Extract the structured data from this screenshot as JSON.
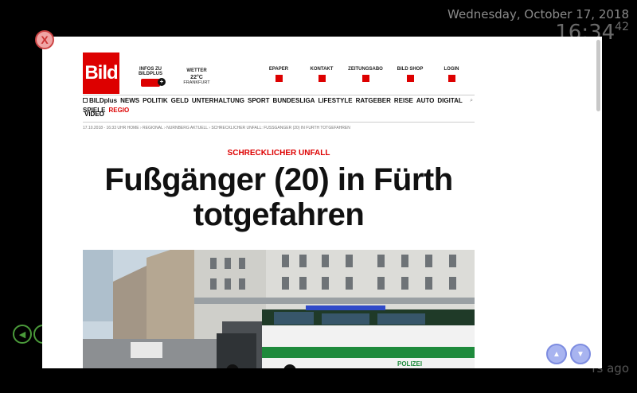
{
  "clock": {
    "date": "Wednesday, October 17, 2018",
    "time": "16:34",
    "seconds": "42"
  },
  "status": {
    "ago_text": "rs ago"
  },
  "overlay": {
    "close_label": "X",
    "prev_label": "◀",
    "up_label": "▲",
    "down_label": "▼"
  },
  "site": {
    "logo_text": "Bild",
    "header": {
      "bildplus_label": "INFOS ZU BILDPLUS",
      "weather_label": "WETTER",
      "weather_temp": "22°C",
      "weather_city": "FRANKFURT",
      "epaper_label": "EPAPER",
      "kontakt_label": "KONTAKT",
      "zeitungsabo_label": "ZEITUNGSABO",
      "shop_label": "BILD SHOP",
      "login_label": "LOGIN"
    },
    "menu": [
      "BILDplus",
      "NEWS",
      "POLITIK",
      "GELD",
      "UNTERHALTUNG",
      "SPORT",
      "BUNDESLIGA",
      "LIFESTYLE",
      "RATGEBER",
      "REISE",
      "AUTO",
      "DIGITAL",
      "SPIELE"
    ],
    "menu_regio": "REGIO",
    "menu_video": "VIDEO",
    "breadcrumb": "17.10.2018 - 16:33 UHR   HOME › REGIONAL › NÜRNBERG AKTUELL › SCHRECKLICHER UNFALL: FUSSGÄNGER (20) IN FÜRTH TOTGEFAHREN",
    "article": {
      "kicker": "SCHRECKLICHER UNFALL",
      "headline_line1": "Fußgänger (20) in Fürth",
      "headline_line2": "totgefahren"
    },
    "photo": {
      "polizei_text": "POLIZEI"
    }
  }
}
